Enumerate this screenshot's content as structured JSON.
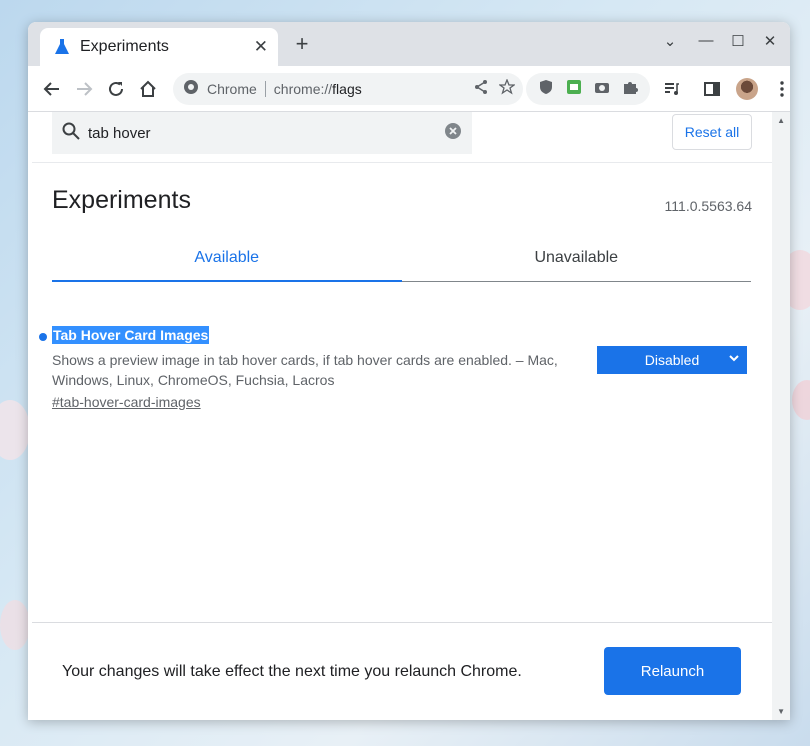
{
  "browser": {
    "tab_title": "Experiments",
    "omnibox_site": "Chrome",
    "omnibox_url_prefix": "chrome://",
    "omnibox_url_path": "flags",
    "accent_color": "#1a73e8"
  },
  "search": {
    "query": "tab hover"
  },
  "header": {
    "reset_label": "Reset all",
    "title": "Experiments",
    "version": "111.0.5563.64"
  },
  "tabs": [
    {
      "label": "Available",
      "active": true
    },
    {
      "label": "Unavailable",
      "active": false
    }
  ],
  "flag": {
    "name": "Tab Hover Card Images",
    "description": "Shows a preview image in tab hover cards, if tab hover cards are enabled. – Mac, Windows, Linux, ChromeOS, Fuchsia, Lacros",
    "link": "#tab-hover-card-images",
    "state": "Disabled"
  },
  "footer": {
    "message": "Your changes will take effect the next time you relaunch Chrome.",
    "relaunch_label": "Relaunch"
  }
}
